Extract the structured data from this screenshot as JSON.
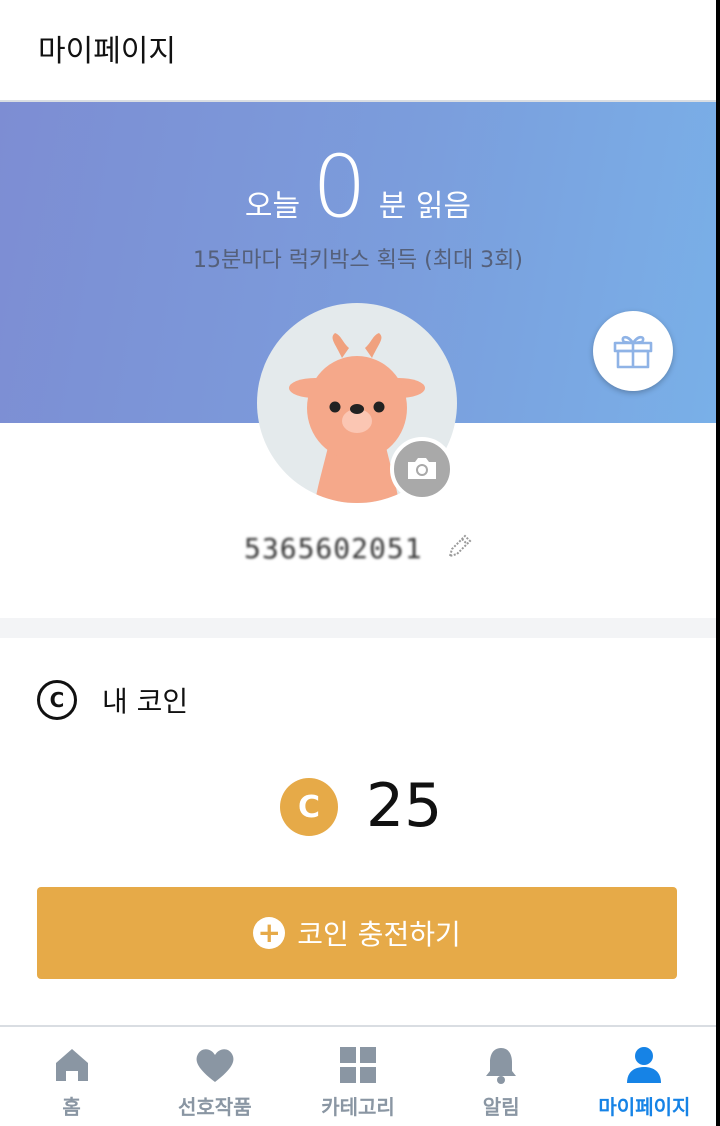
{
  "header": {
    "title": "마이페이지"
  },
  "reading": {
    "prefix": "오늘",
    "minutes": "0",
    "suffix": "분 읽음",
    "subtitle": "15분마다 럭키박스 획득 (최대 3회)"
  },
  "profile": {
    "nickname": "5365602051",
    "avatar_icon": "deer-avatar",
    "camera_icon": "camera-icon",
    "edit_icon": "pencil-icon",
    "gift_icon": "gift-icon"
  },
  "coins": {
    "section_label": "내 코인",
    "coin_symbol": "C",
    "balance": "25",
    "charge_label": "코인 충전하기",
    "accent_color": "#e6aa48"
  },
  "tabs": [
    {
      "label": "홈",
      "icon": "home-icon",
      "active": false
    },
    {
      "label": "선호작품",
      "icon": "heart-icon",
      "active": false
    },
    {
      "label": "카테고리",
      "icon": "grid-icon",
      "active": false
    },
    {
      "label": "알림",
      "icon": "bell-icon",
      "active": false
    },
    {
      "label": "마이페이지",
      "icon": "person-icon",
      "active": true
    }
  ],
  "colors": {
    "banner_start": "#7d8dd3",
    "banner_end": "#79b0e8",
    "tab_active": "#1683e6",
    "tab_inactive": "#8a96a3"
  }
}
